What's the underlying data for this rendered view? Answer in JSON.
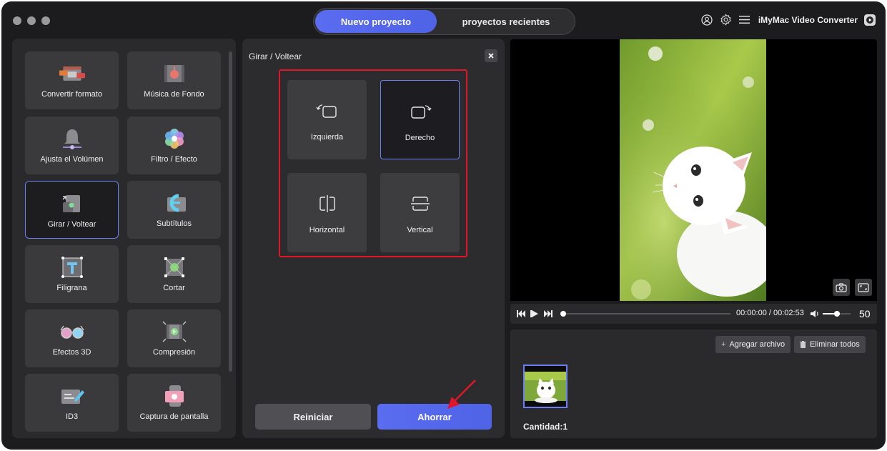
{
  "window": {
    "tabs": {
      "active": "Nuevo proyecto",
      "inactive": "proyectos recientes"
    },
    "brand": "iMyMac Video Converter"
  },
  "tools": [
    {
      "label": "Convertir formato",
      "icon": "convert-format-icon"
    },
    {
      "label": "Música de Fondo",
      "icon": "background-music-icon"
    },
    {
      "label": "Ajusta el Volúmen",
      "icon": "volume-adjust-icon"
    },
    {
      "label": "Filtro / Efecto",
      "icon": "filter-effect-icon"
    },
    {
      "label": "Girar / Voltear",
      "icon": "rotate-flip-icon",
      "active": true
    },
    {
      "label": "Subtítulos",
      "icon": "subtitles-icon"
    },
    {
      "label": "Filigrana",
      "icon": "watermark-icon"
    },
    {
      "label": "Cortar",
      "icon": "crop-icon"
    },
    {
      "label": "Efectos 3D",
      "icon": "3d-glasses-icon"
    },
    {
      "label": "Compresión",
      "icon": "compression-icon"
    },
    {
      "label": "ID3",
      "icon": "id3-tag-icon"
    },
    {
      "label": "Captura de pantalla",
      "icon": "screen-capture-icon"
    }
  ],
  "panel": {
    "title": "Girar / Voltear",
    "options": [
      {
        "label": "Izquierda",
        "icon": "rotate-left-icon"
      },
      {
        "label": "Derecho",
        "icon": "rotate-right-icon",
        "active": true
      },
      {
        "label": "Horizontal",
        "icon": "flip-horizontal-icon"
      },
      {
        "label": "Vertical",
        "icon": "flip-vertical-icon"
      }
    ],
    "reset_label": "Reiniciar",
    "save_label": "Ahorrar"
  },
  "player": {
    "time": "00:00:00 / 00:02:53",
    "volume": "50",
    "progress": 0
  },
  "files": {
    "add_label": "Agregar archivo",
    "remove_all_label": "Eliminar todos",
    "quantity": "Cantidad:1"
  },
  "colors": {
    "accent": "#5a6cf0",
    "highlight_box": "#e1152a",
    "background": "#1c1c1e"
  }
}
